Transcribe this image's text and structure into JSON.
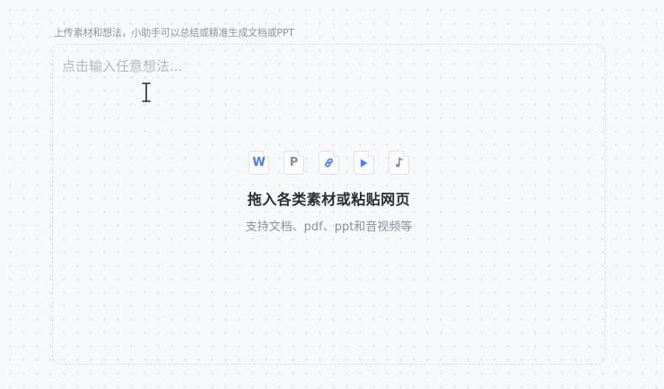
{
  "hint": "上传素材和想法，小助手可以总结或精准生成文档或PPT",
  "input": {
    "placeholder": "点击输入任意想法..."
  },
  "drop": {
    "title": "拖入各类素材或粘贴网页",
    "subtitle": "支持文档、pdf、ppt和音视频等"
  },
  "file_icons": [
    {
      "name": "word-file-icon",
      "glyph": "W",
      "color": "#4a7ef0"
    },
    {
      "name": "pdf-file-icon",
      "glyph": "P",
      "color": "#8a8f98"
    },
    {
      "name": "link-file-icon",
      "glyph": "link",
      "color": "#4a7ef0"
    },
    {
      "name": "video-file-icon",
      "glyph": "play",
      "color": "#4a7ef0"
    },
    {
      "name": "audio-file-icon",
      "glyph": "note",
      "color": "#8a8f98"
    }
  ]
}
